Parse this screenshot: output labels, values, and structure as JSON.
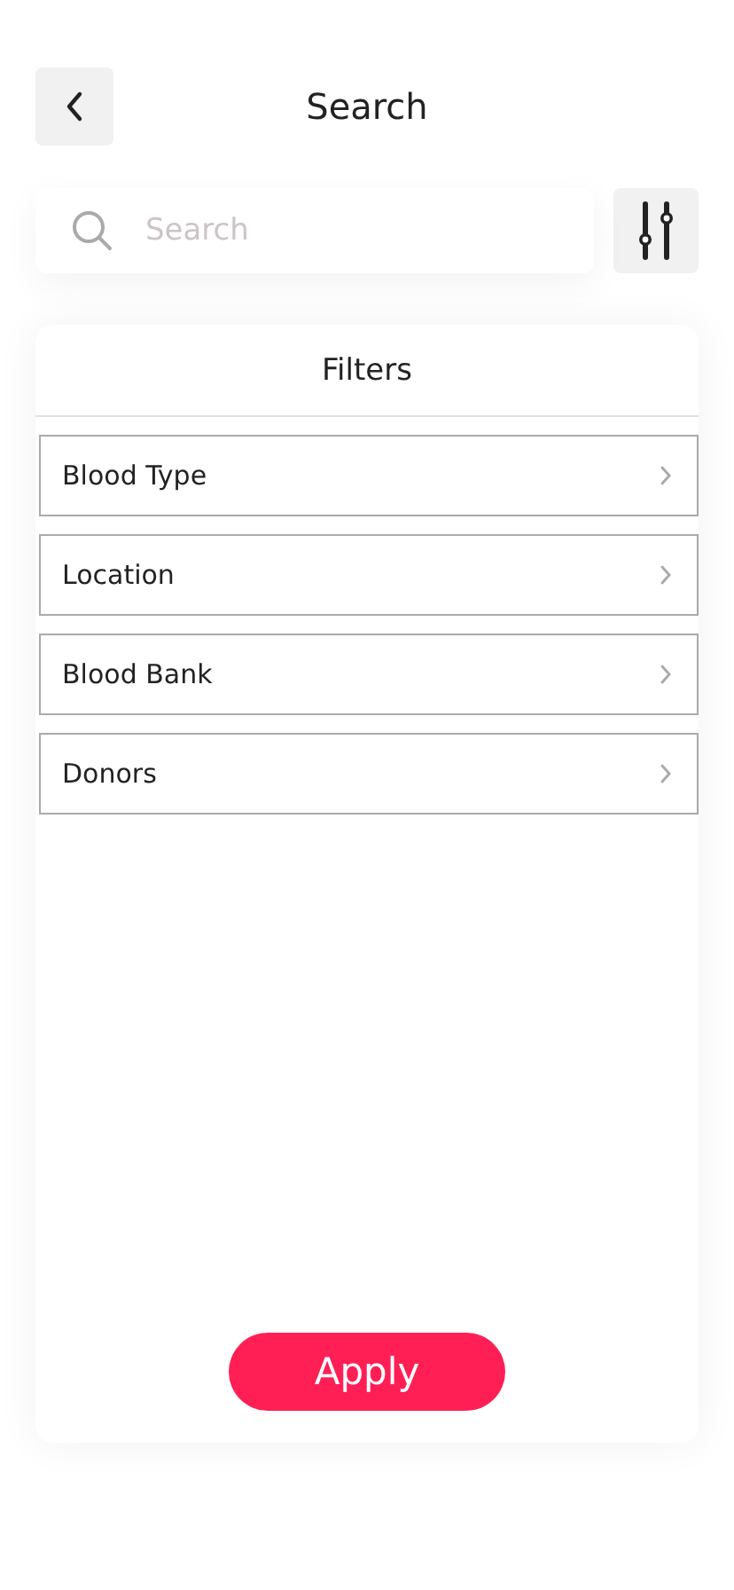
{
  "header": {
    "title": "Search"
  },
  "search": {
    "placeholder": "Search"
  },
  "filters": {
    "title": "Filters",
    "items": [
      {
        "label": "Blood Type"
      },
      {
        "label": "Location"
      },
      {
        "label": "Blood Bank"
      },
      {
        "label": "Donors"
      }
    ]
  },
  "apply_button": {
    "label": "Apply"
  }
}
